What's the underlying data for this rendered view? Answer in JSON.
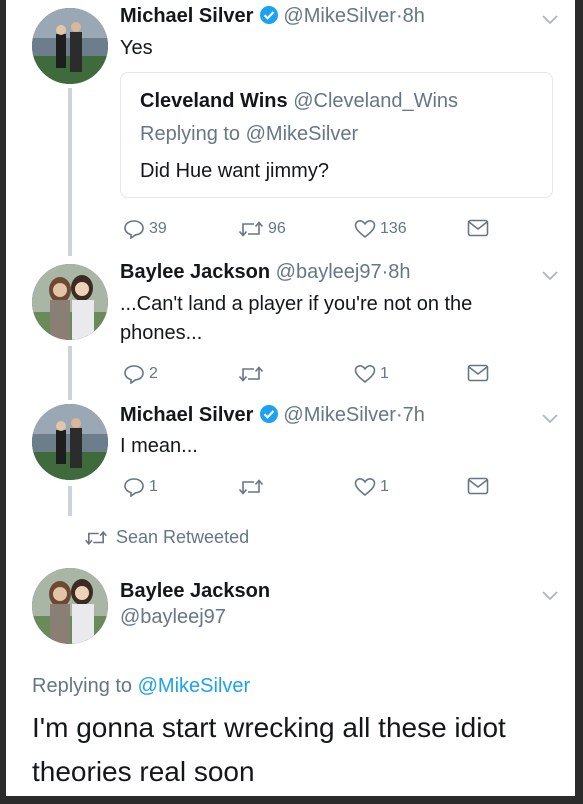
{
  "thread": {
    "tweet1": {
      "name": "Michael Silver",
      "handle": "@MikeSilver",
      "dot": "·",
      "time": "8h",
      "text": "Yes",
      "quote": {
        "name": "Cleveland Wins",
        "handle": "@Cleveland_Wins",
        "replying": "Replying to @MikeSilver",
        "text": "Did Hue want jimmy?"
      },
      "replies": "39",
      "retweets": "96",
      "likes": "136"
    },
    "tweet2": {
      "name": "Baylee Jackson",
      "handle": "@bayleej97",
      "dot": "·",
      "time": "8h",
      "text_line1": "...Can't land a player if you're not on the",
      "text_line2": "phones...",
      "replies": "2",
      "retweets": "",
      "likes": "1"
    },
    "tweet3": {
      "name": "Michael Silver",
      "handle": "@MikeSilver",
      "dot": "·",
      "time": "7h",
      "text": "I mean...",
      "replies": "1",
      "retweets": "",
      "likes": "1"
    }
  },
  "retweet_context": "Sean Retweeted",
  "main_tweet": {
    "name": "Baylee Jackson",
    "handle": "@bayleej97",
    "replying_prefix": "Replying to ",
    "replying_handle": "@MikeSilver",
    "text_line1": "I'm gonna start wrecking all these idiot",
    "text_line2": "theories real soon"
  },
  "icons": {
    "verified": "verified-badge-icon",
    "reply": "reply-icon",
    "retweet": "retweet-icon",
    "like": "heart-icon",
    "dm": "envelope-icon",
    "more": "chevron-down-icon"
  },
  "colors": {
    "text": "#14171a",
    "secondary": "#657786",
    "verified": "#1da1f2",
    "thread_line": "#cbd4dc"
  }
}
